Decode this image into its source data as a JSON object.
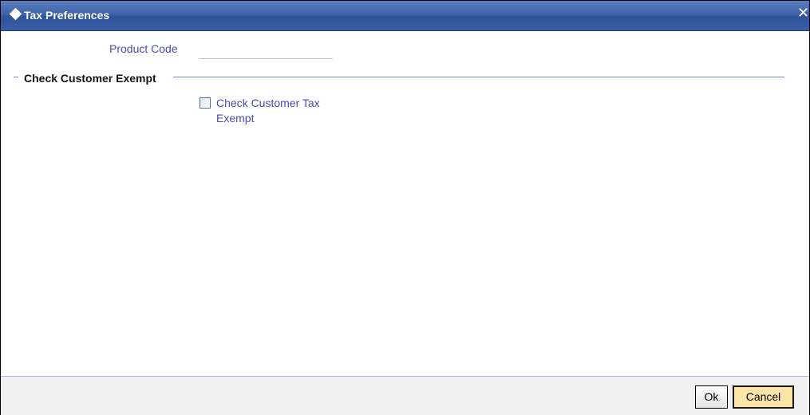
{
  "window": {
    "title": "Tax Preferences",
    "close_glyph": "✕"
  },
  "form": {
    "product_code_label": "Product Code",
    "product_code_value": "",
    "section_title": "Check Customer Exempt",
    "exempt_checkbox_label": "Check Customer Tax Exempt",
    "exempt_checked": false
  },
  "footer": {
    "ok_label": "Ok",
    "cancel_label": "Cancel"
  },
  "colors": {
    "title_bar": "#3e63a9",
    "label_blue": "#4b4bb0",
    "cancel_bg": "#ffe4a8"
  },
  "icons": {
    "title": "diamond-icon",
    "close": "close-icon"
  }
}
